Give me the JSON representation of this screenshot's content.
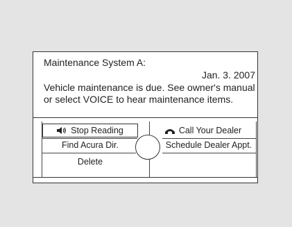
{
  "screen": {
    "title": "Maintenance System A:",
    "date": "Jan. 3. 2007",
    "message": "Vehicle maintenance is due. See owner's manual or select VOICE to hear maintenance items."
  },
  "buttons": {
    "stop_reading": "Stop Reading",
    "call_dealer": "Call Your Dealer",
    "find_dir": "Find Acura Dir.",
    "schedule_appt": "Schedule Dealer Appt.",
    "delete": "Delete"
  },
  "icons": {
    "stop_reading": "speaker-icon",
    "call_dealer": "phone-icon",
    "knob": "interface-dial"
  },
  "colors": {
    "background": "#e4e4e4",
    "screen": "#ffffff",
    "border": "#333333",
    "text": "#222222"
  }
}
